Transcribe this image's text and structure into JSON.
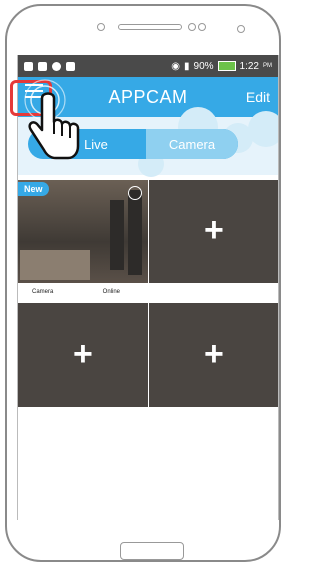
{
  "statusbar": {
    "battery": "90%",
    "time": "1:22",
    "time_suffix": "PM"
  },
  "appbar": {
    "title": "APPCAM",
    "edit_label": "Edit"
  },
  "tabs": {
    "live_label": "Live",
    "camera_label": "Camera"
  },
  "cameras": [
    {
      "badge": "New",
      "name": "Camera",
      "status": "Online"
    }
  ],
  "add_label": "+",
  "colors": {
    "accent": "#36a9e6",
    "highlight": "#e53939",
    "online": "#6cc24a"
  }
}
